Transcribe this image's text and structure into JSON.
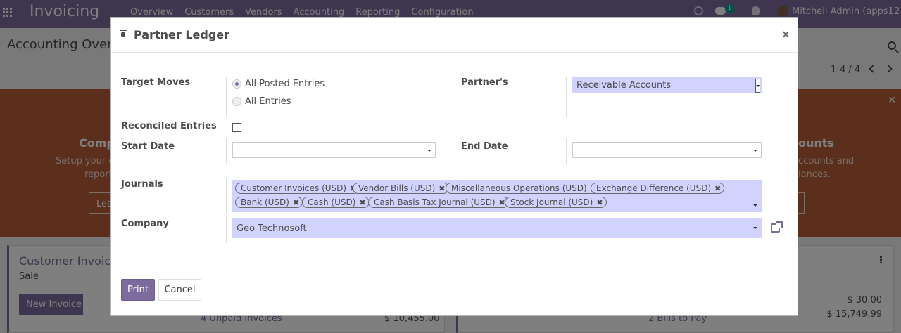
{
  "app": {
    "brand": "Invoicing",
    "menu": [
      "Overview",
      "Customers",
      "Vendors",
      "Accounting",
      "Reporting",
      "Configuration"
    ],
    "chat_count": "1",
    "user": "Mitchell Admin (apps12)"
  },
  "control_panel": {
    "title": "Accounting Overvi",
    "pager": "1-4 / 4"
  },
  "banner": {
    "left_title": "Comp",
    "left_text1": "Setup your c",
    "left_text2": "report",
    "left_button": "Let",
    "right_title": "ounts",
    "right_text1": "ccounts and",
    "right_text2": "lances."
  },
  "dashboard": {
    "card_left": {
      "title": "Customer Invoices",
      "subtitle": "Sale",
      "button": "New Invoice",
      "link": "4 Unpaid Invoices",
      "amount": "$ 10,455.00"
    },
    "card_right": {
      "amount1": "$ 30.00",
      "amount2": "$ 15,749.99",
      "link": "2 Bills to Pay"
    }
  },
  "dialog": {
    "title": "Partner Ledger",
    "close": "×",
    "target_moves": {
      "label": "Target Moves",
      "options": [
        "All Posted Entries",
        "All Entries"
      ],
      "selected": "All Posted Entries"
    },
    "partners": {
      "label": "Partner's",
      "value": "Receivable Accounts"
    },
    "reconciled": {
      "label": "Reconciled Entries",
      "checked": false
    },
    "start_date": {
      "label": "Start Date",
      "value": ""
    },
    "end_date": {
      "label": "End Date",
      "value": ""
    },
    "journals": {
      "label": "Journals",
      "tags_row1": [
        "Customer Invoices (USD)",
        "Vendor Bills (USD)",
        "Miscellaneous Operations (USD)",
        "Exchange Difference (USD)"
      ],
      "tags_row2": [
        "Bank (USD)",
        "Cash (USD)",
        "Cash Basis Tax Journal (USD)",
        "Stock Journal (USD)"
      ]
    },
    "company": {
      "label": "Company",
      "value": "Geo Technosoft"
    },
    "buttons": {
      "print": "Print",
      "cancel": "Cancel"
    }
  },
  "colors": {
    "primary": "#7c6b9c",
    "banner": "#b85e3a",
    "required_field": "#d2d2ff"
  }
}
